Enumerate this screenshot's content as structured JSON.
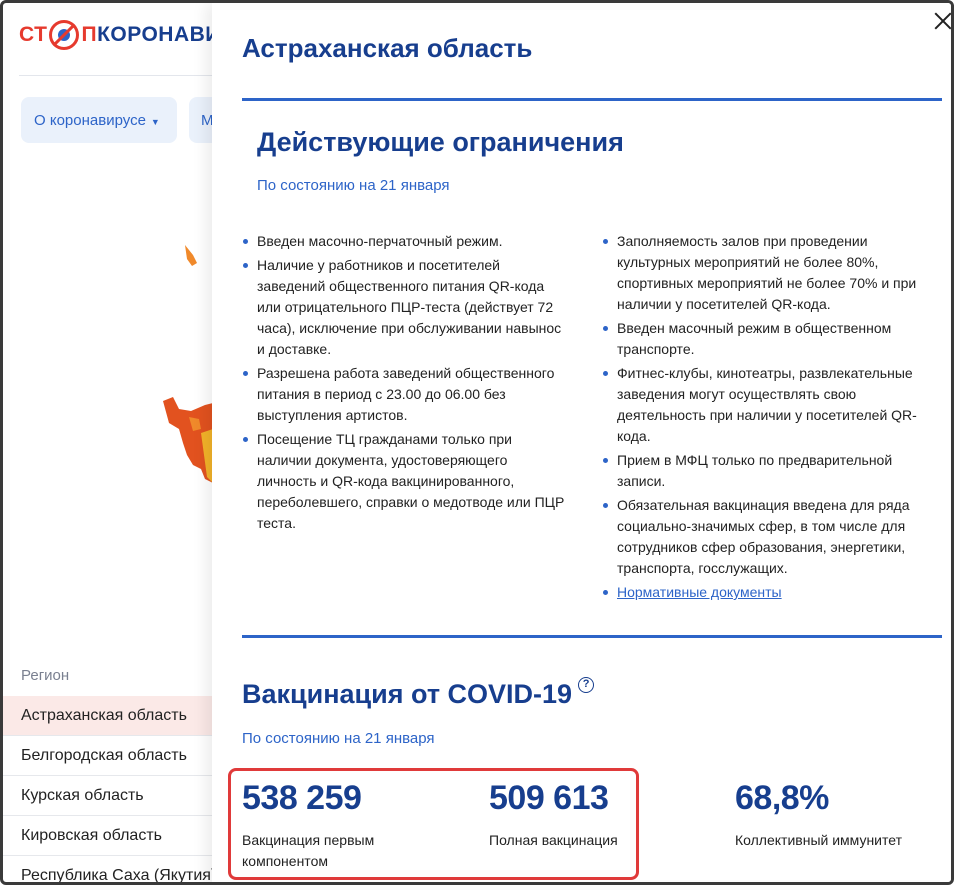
{
  "background": {
    "logo": {
      "part1": "СТ",
      "part2": "П",
      "part3": "КОРОНАВИ"
    },
    "nav": {
      "about": "О коронавирусе",
      "second": "М"
    },
    "region_header": "Регион",
    "regions": [
      "Астраханская область",
      "Белгородская область",
      "Курская область",
      "Кировская область",
      "Республика Саха (Якутия)"
    ]
  },
  "panel": {
    "title": "Астраханская область",
    "restrictions": {
      "title": "Действующие ограничения",
      "date": "По состоянию на 21 января",
      "left": [
        "Введен масочно-перчаточный режим.",
        "Наличие у работников и посетителей заведений общественного питания QR-кода или отрицательного ПЦР-теста (действует 72 часа), исключение при обслуживании навынос и доставке.",
        "Разрешена работа заведений общественного питания в период с 23.00 до 06.00 без выступления артистов.",
        "Посещение ТЦ гражданами только при наличии документа, удостоверяющего личность и QR-кода вакцинированного, переболевшего, справки о медотводе или ПЦР теста."
      ],
      "right": [
        "Заполняемость залов при проведении культурных мероприятий не более 80%, спортивных мероприятий не более 70% и при наличии у посетителей QR-кода.",
        "Введен масочный режим в общественном транспорте.",
        "Фитнес-клубы, кинотеатры, развлекательные заведения могут осуществлять свою деятельность при наличии у посетителей QR-кода.",
        "Прием в МФЦ только по предварительной записи.",
        "Обязательная вакцинация введена для ряда социально-значимых сфер, в том числе для сотрудников сфер образования, энергетики, транспорта, госслужащих."
      ],
      "docs_link": "Нормативные документы"
    },
    "vaccination": {
      "title": "Вакцинация от COVID-19",
      "help": "?",
      "date": "По состоянию на 21 января",
      "stats": [
        {
          "value": "538 259",
          "label": "Вакцинация первым компонентом"
        },
        {
          "value": "509 613",
          "label": "Полная вакцинация"
        },
        {
          "value": "68,8%",
          "label": "Коллективный иммунитет"
        }
      ]
    }
  },
  "colors": {
    "brand_blue": "#173e8e",
    "link_blue": "#2d64c8",
    "brand_red": "#e63a2e",
    "highlight": "#e03a3a"
  }
}
